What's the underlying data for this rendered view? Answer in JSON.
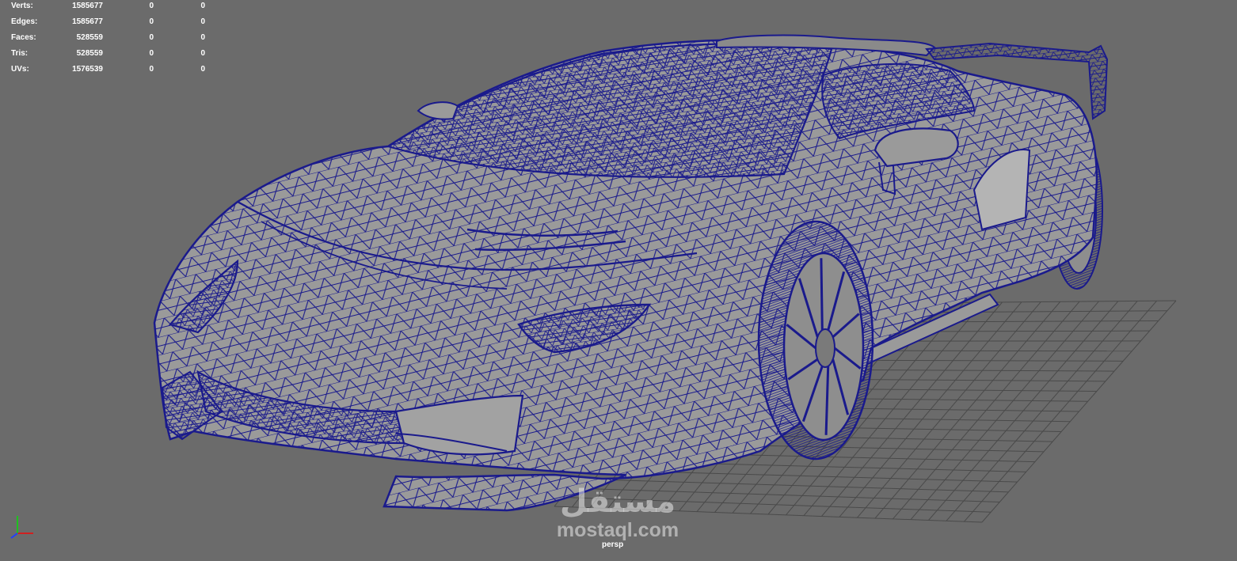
{
  "heads_up_display": {
    "rows": [
      {
        "label": "Verts:",
        "total": "1585677",
        "selected": "0",
        "selected_uv": "0"
      },
      {
        "label": "Edges:",
        "total": "1585677",
        "selected": "0",
        "selected_uv": "0"
      },
      {
        "label": "Faces:",
        "total": "528559",
        "selected": "0",
        "selected_uv": "0"
      },
      {
        "label": "Tris:",
        "total": "528559",
        "selected": "0",
        "selected_uv": "0"
      },
      {
        "label": "UVs:",
        "total": "1576539",
        "selected": "0",
        "selected_uv": "0"
      }
    ]
  },
  "viewport": {
    "camera_label": "persp",
    "background_color": "#6b6b6b",
    "wireframe_color": "#1a1a8c",
    "surface_color": "#9a9a9a",
    "grid_color": "#4a4a4a"
  },
  "axis_gizmo": {
    "icon": "axis-triad-icon",
    "x_color": "#d02020",
    "y_color": "#20c020",
    "z_color": "#2040ff"
  },
  "watermark": {
    "arabic": "مستقل",
    "latin": "mostaql.com"
  }
}
